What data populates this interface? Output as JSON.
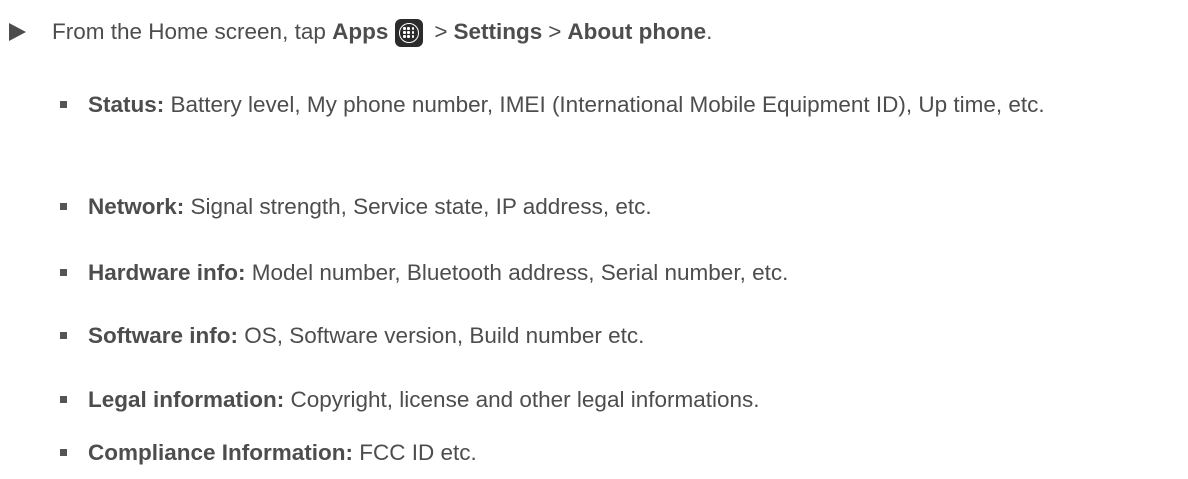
{
  "step": {
    "prefix": "From the Home screen, tap",
    "apps": "Apps",
    "sep1": ">",
    "settings": "Settings",
    "sep2": ">",
    "about": "About phone",
    "end": "."
  },
  "items": [
    {
      "term": "Status:",
      "text": " Battery level, My phone number, IMEI (International Mobile Equipment ID), Up time, etc."
    },
    {
      "term": "Network:",
      "text": " Signal strength, Service state, IP address, etc."
    },
    {
      "term": "Hardware info:",
      "text": " Model number, Bluetooth address, Serial number, etc."
    },
    {
      "term": "Software info:",
      "text": " OS, Software version, Build number etc."
    },
    {
      "term": "Legal information:",
      "text": " Copyright, license and other legal informations."
    },
    {
      "term": "Compliance Information:",
      "text": " FCC ID etc."
    }
  ],
  "colors": {
    "text": "#4d4d4d",
    "icon_bg": "#2b2b2b"
  },
  "icons": {
    "step_marker": "triangle-right-icon",
    "apps": "apps-grid-icon",
    "bullet": "square-bullet-icon"
  }
}
